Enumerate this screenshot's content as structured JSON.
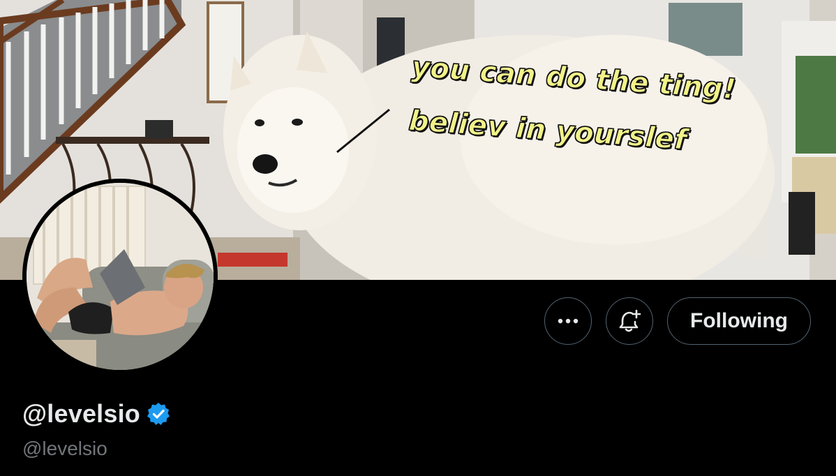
{
  "banner": {
    "caption_line1": "you can do the ting!",
    "caption_line2": "believ in yourslef",
    "caption_color": "#f2f28a"
  },
  "actions": {
    "more_icon": "more-horizontal-icon",
    "notify_icon": "bell-plus-icon",
    "following_label": "Following"
  },
  "profile": {
    "display_name": "@levelsio",
    "verified_icon": "verified-badge-icon",
    "verified_color": "#1d9bf0",
    "handle": "@levelsio"
  },
  "colors": {
    "background": "#000000",
    "text_primary": "#e7e9ea",
    "text_secondary": "#71767b",
    "border": "#536471"
  }
}
